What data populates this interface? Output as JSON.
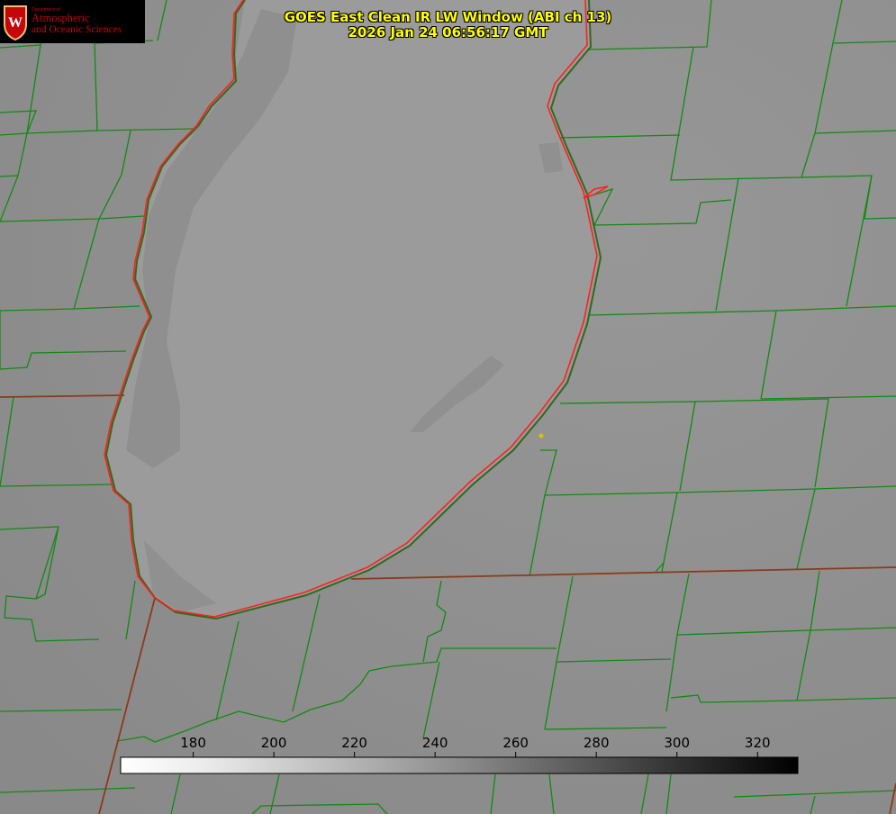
{
  "title": {
    "line1": "GOES East Clean IR LW Window (ABI ch 13)",
    "line2": "2026 Jan 24 06:56:17 GMT"
  },
  "logo": {
    "dept": "Department of",
    "line1": "Atmospheric",
    "line2": "and Oceanic Sciences",
    "seal_letter": "W"
  },
  "colorbar": {
    "min": 162,
    "max": 330,
    "ticks": [
      180,
      200,
      220,
      240,
      260,
      280,
      300,
      320
    ]
  },
  "colors": {
    "title": "#ffff00",
    "county_lines": "#138a13",
    "shoreline": "#ff2020",
    "state_lines": "#8b3a1a",
    "background": "#8f8f8f",
    "lake": "#9a9a9a"
  }
}
